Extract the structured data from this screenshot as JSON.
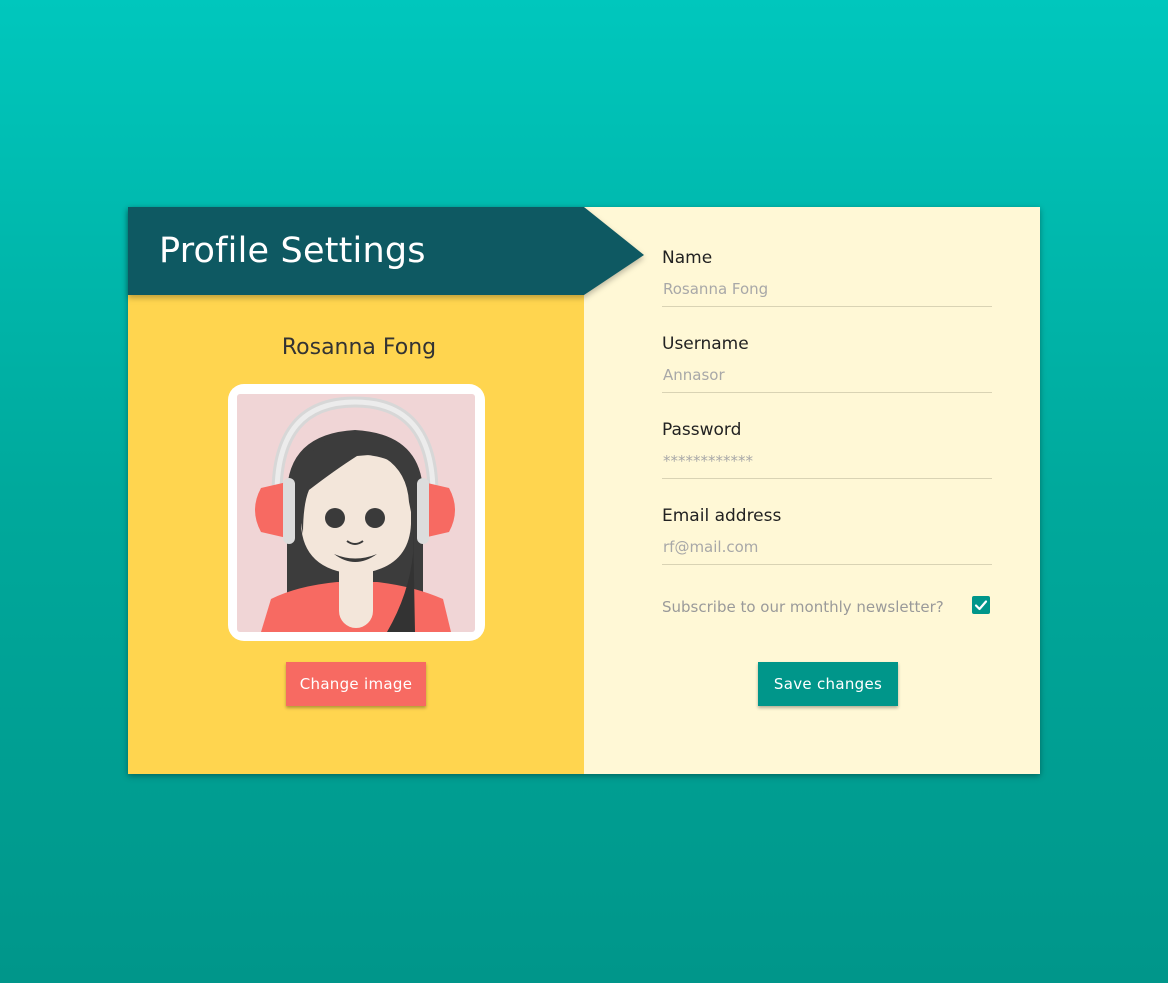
{
  "header": {
    "title": "Profile Settings"
  },
  "profile": {
    "display_name": "Rosanna Fong"
  },
  "buttons": {
    "change_image": "Change image",
    "save_changes": "Save changes"
  },
  "form": {
    "name": {
      "label": "Name",
      "placeholder": "Rosanna Fong"
    },
    "username": {
      "label": "Username",
      "placeholder": "Annasor"
    },
    "password": {
      "label": "Password",
      "placeholder": "************"
    },
    "email": {
      "label": "Email address",
      "placeholder": "rf@mail.com"
    },
    "newsletter": {
      "label": "Subscribe to our monthly newsletter?",
      "checked": true
    }
  },
  "colors": {
    "background_top": "#00c7bd",
    "background_bottom": "#00968a",
    "banner": "#0e5962",
    "left_panel": "#ffd54f",
    "right_panel": "#fff8d6",
    "change_button": "#f76a62",
    "save_button": "#00968a"
  },
  "icons": {
    "avatar": "avatar-image",
    "checkbox": "check-icon"
  }
}
